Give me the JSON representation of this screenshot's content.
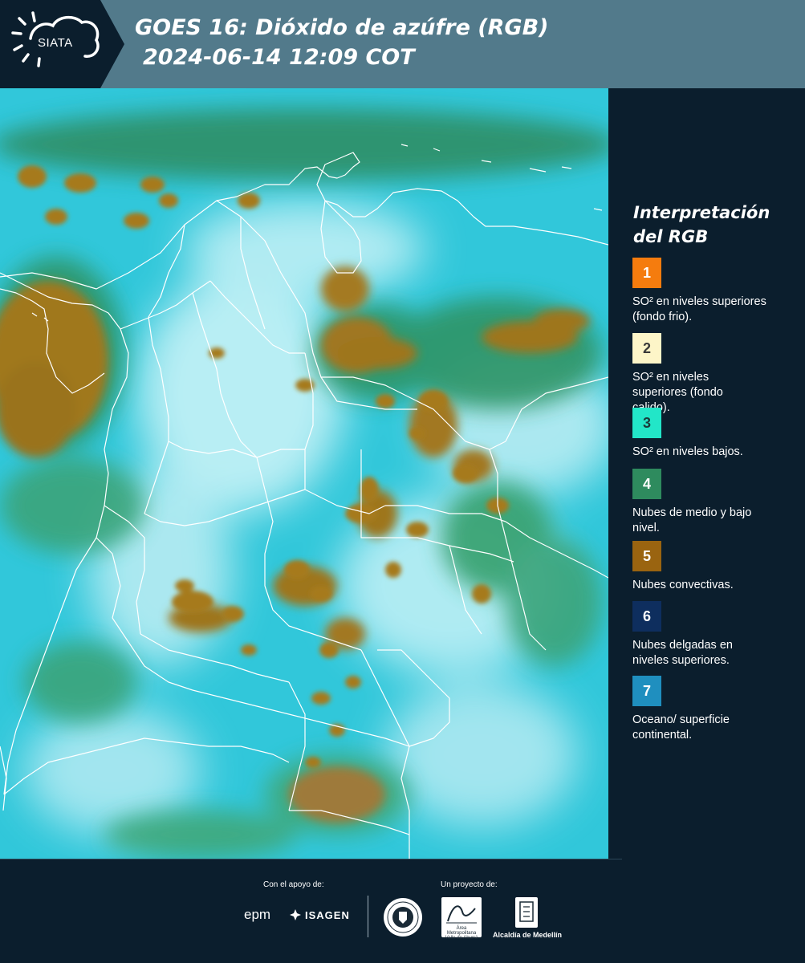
{
  "header": {
    "brand": "SIATA",
    "title_line1": "GOES 16: Dióxido de azúfre (RGB)",
    "title_line2": "2024-06-14 12:09 COT"
  },
  "colors": {
    "header_bg": "#527a8b",
    "dark_bg": "#0b1e2d",
    "ocean_surface": "#32c8da",
    "convective": "#a0761c",
    "mid_low_cloud": "#2f9a6a"
  },
  "legend": {
    "title": "Interpretación del RGB",
    "items": [
      {
        "number": "1",
        "color": "#f57c0e",
        "text_color": "#ffffff",
        "label": "SO² en niveles superiores (fondo frio)."
      },
      {
        "number": "2",
        "color": "#fdf5c8",
        "text_color": "#3a3a3a",
        "label": "SO² en niveles superiores (fondo calido)."
      },
      {
        "number": "3",
        "color": "#22e6c8",
        "text_color": "#1a3a3a",
        "label": "SO² en niveles bajos."
      },
      {
        "number": "4",
        "color": "#2e8b5e",
        "text_color": "#ffffff",
        "label": "Nubes de medio y bajo nivel."
      },
      {
        "number": "5",
        "color": "#9a6410",
        "text_color": "#ffffff",
        "label": "Nubes convectivas."
      },
      {
        "number": "6",
        "color": "#0e2e5e",
        "text_color": "#ffffff",
        "label": "Nubes delgadas en niveles superiores."
      },
      {
        "number": "7",
        "color": "#1f8fbf",
        "text_color": "#ffffff",
        "label": "Oceano/ superficie continental."
      }
    ]
  },
  "footer": {
    "support_label": "Con el apoyo de:",
    "project_label": "Un proyecto de:",
    "sponsor_1": "epm",
    "sponsor_2": "ISAGEN",
    "partner_1": "Área Metropolitana Valle de Aburrá",
    "partner_2": "Alcaldía de Medellín"
  }
}
